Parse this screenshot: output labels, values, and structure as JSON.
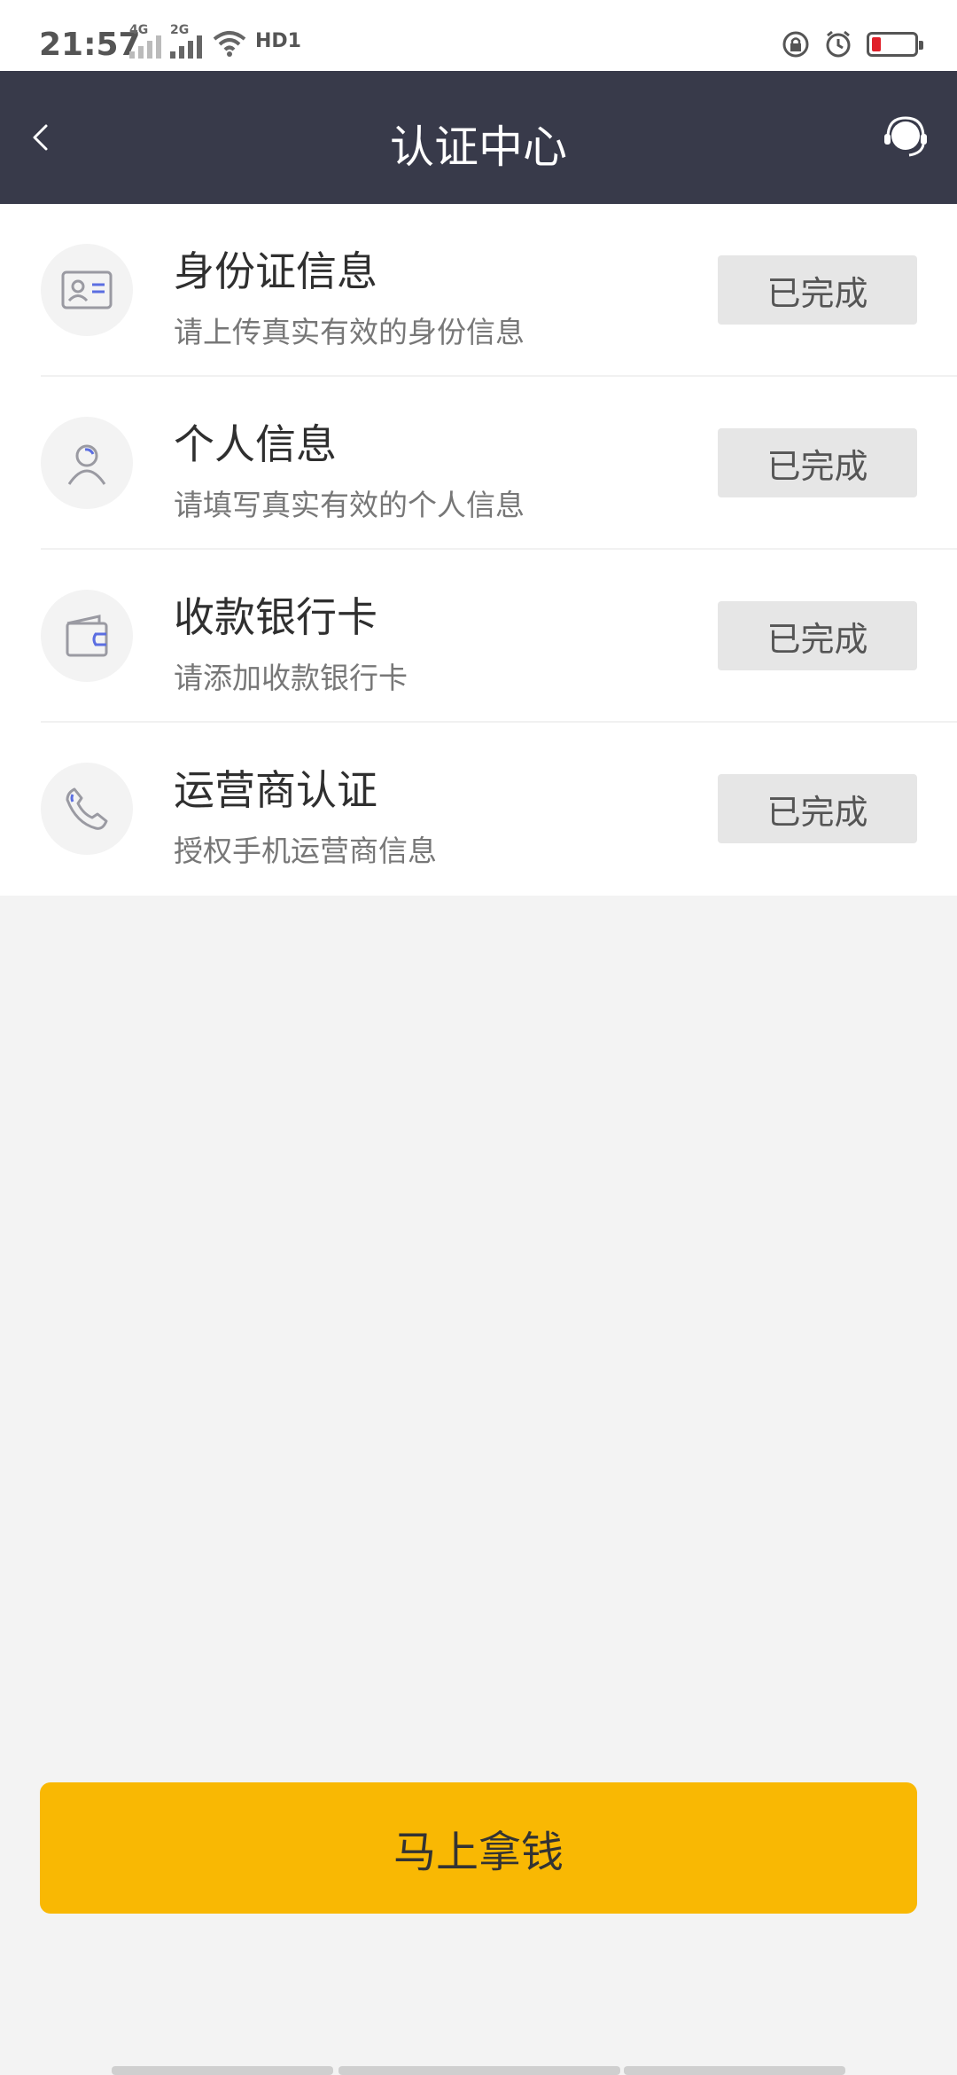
{
  "status_bar": {
    "time": "21:57",
    "net1": "4G",
    "net2": "2G",
    "hd": "HD1"
  },
  "nav": {
    "title": "认证中心",
    "back_icon": "back-chevron-icon",
    "support_icon": "customer-service-icon"
  },
  "items": [
    {
      "icon": "id-card-icon",
      "name": "身份证信息",
      "desc": "请上传真实有效的身份信息",
      "status": "已完成"
    },
    {
      "icon": "person-icon",
      "name": "个人信息",
      "desc": "请填写真实有效的个人信息",
      "status": "已完成"
    },
    {
      "icon": "wallet-icon",
      "name": "收款银行卡",
      "desc": "请添加收款银行卡",
      "status": "已完成"
    },
    {
      "icon": "phone-icon",
      "name": "运营商认证",
      "desc": "授权手机运营商信息",
      "status": "已完成"
    }
  ],
  "cta": {
    "label": "马上拿钱"
  },
  "colors": {
    "nav_bg": "#383a4a",
    "cta_bg": "#f9b803",
    "accent_blue": "#5b6ee1",
    "page_bg": "#f3f3f3"
  }
}
